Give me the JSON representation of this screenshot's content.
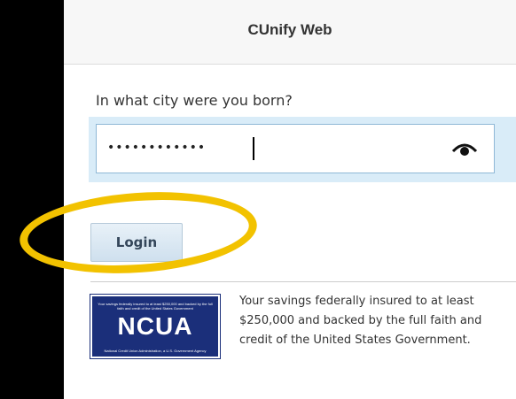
{
  "header": {
    "title": "CUnify Web"
  },
  "form": {
    "question_label": "In what city were you born?",
    "answer_masked": "••••••••••••",
    "reveal_icon": "eye-icon"
  },
  "actions": {
    "login_label": "Login"
  },
  "footer": {
    "ncua_logo_text": "NCUA",
    "ncua_logo_top": "Your savings federally insured to at least $250,000 and backed by the full faith and credit of the United States Government",
    "ncua_logo_bottom": "National Credit Union Administration, a U.S. Government Agency",
    "insured_text": "Your savings federally insured to at least $250,000 and backed by the full faith and credit of the United States Government."
  },
  "colors": {
    "highlight": "#f2c200",
    "ncua_blue": "#1b2f7a",
    "background": "#000000"
  }
}
